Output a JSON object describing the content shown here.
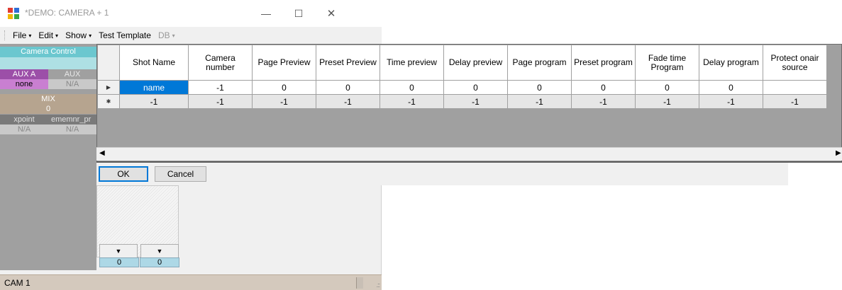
{
  "window": {
    "title": "*DEMO: CAMERA + 1",
    "minimize": "—",
    "maximize": "☐",
    "close": "✕"
  },
  "menu": [
    {
      "label": "File",
      "caret": "▾",
      "enabled": true
    },
    {
      "label": "Edit",
      "caret": "▾",
      "enabled": true
    },
    {
      "label": "Show",
      "caret": "▾",
      "enabled": true
    },
    {
      "label": "Test Template",
      "caret": "",
      "enabled": true
    },
    {
      "label": "DB",
      "caret": "▾",
      "enabled": false
    }
  ],
  "side_panel": {
    "header": "Camera Control",
    "aux_a_label": "AUX A",
    "aux_label": "AUX",
    "aux_a_value": "none",
    "aux_value": "N/A",
    "mix_label": "MIX",
    "mix_value": "0",
    "xpoint_label": "xpoint",
    "ememnr_label": "ememnr_pr",
    "xpoint_value": "N/A",
    "ememnr_value": "N/A"
  },
  "grid": {
    "columns": [
      "Shot Name",
      "Camera number",
      "Page Preview",
      "Preset Preview",
      "Time preview",
      "Delay preview",
      "Page program",
      "Preset program",
      "Fade time Program",
      "Delay program",
      "Protect onair source"
    ],
    "rows": [
      {
        "marker": "▶",
        "cells": [
          "name",
          "-1",
          "0",
          "0",
          "0",
          "0",
          "0",
          "0",
          "0",
          "0",
          ""
        ]
      },
      {
        "marker": "✱",
        "cells": [
          "-1",
          "-1",
          "-1",
          "-1",
          "-1",
          "-1",
          "-1",
          "-1",
          "-1",
          "-1",
          "-1"
        ]
      }
    ],
    "scroll_left": "◀",
    "scroll_right": "▶"
  },
  "buttons": {
    "ok": "OK",
    "cancel": "Cancel"
  },
  "lower": {
    "dropdown_1": "▼",
    "dropdown_2": "▼",
    "value_1": "0",
    "value_2": "0"
  },
  "status": {
    "label": "CAM 1",
    "grip": ".::"
  },
  "colors": {
    "accent_cyan": "#6bc7cf",
    "aux_a_purple": "#9c4fa8",
    "aux_a_value_bg": "#c97fd1",
    "mix_tan": "#b6a48f",
    "selection_blue": "#0078d7",
    "status_bar": "#d4c9bd"
  }
}
